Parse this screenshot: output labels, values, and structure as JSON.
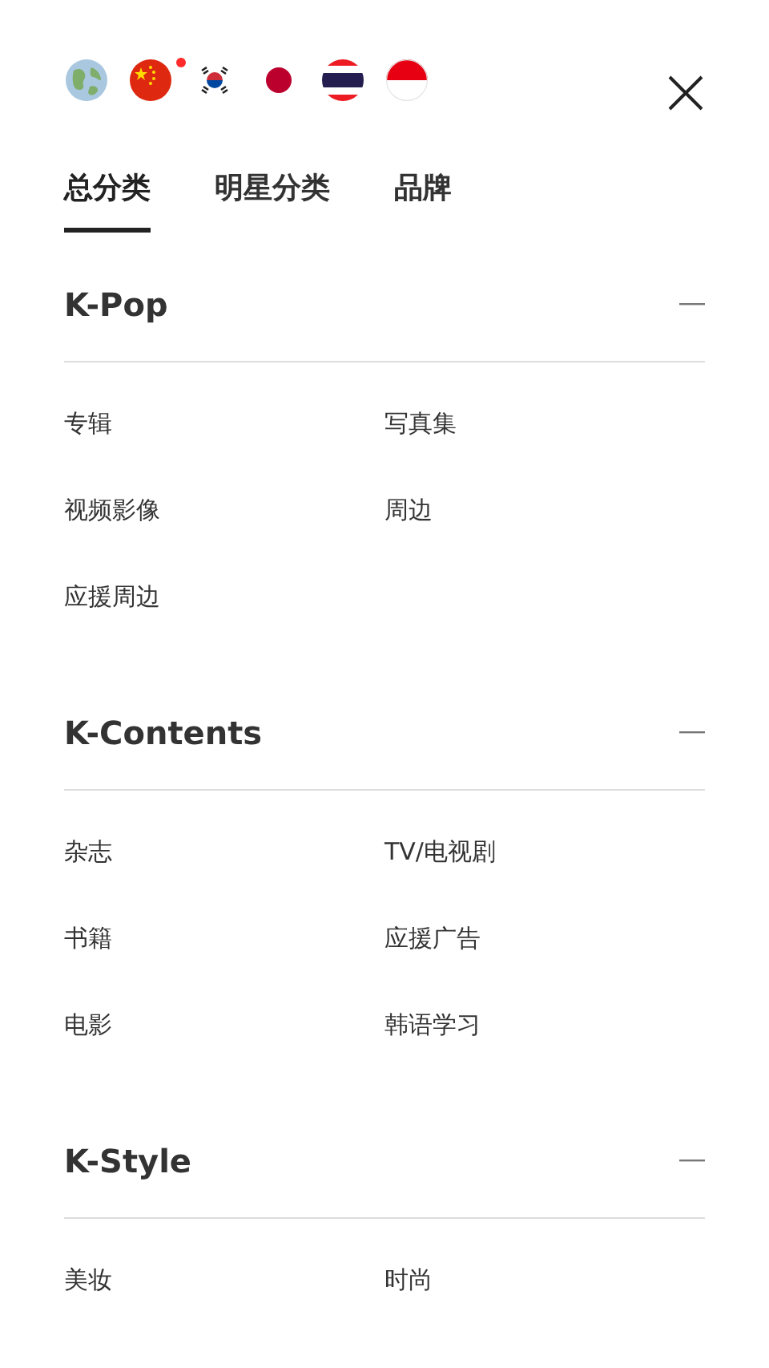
{
  "languages": [
    {
      "kind": "globe",
      "selected": false
    },
    {
      "kind": "china",
      "selected": true
    },
    {
      "kind": "korea",
      "selected": false
    },
    {
      "kind": "japan",
      "selected": false
    },
    {
      "kind": "thailand",
      "selected": false
    },
    {
      "kind": "indonesia",
      "selected": false
    }
  ],
  "tabs": [
    {
      "label": "总分类",
      "selected": true
    },
    {
      "label": "明星分类",
      "selected": false
    },
    {
      "label": "品牌",
      "selected": false
    }
  ],
  "sections": [
    {
      "title": "K-Pop",
      "expanded": true,
      "items": [
        "专辑",
        "写真集",
        "视频影像",
        "周边",
        "应援周边"
      ]
    },
    {
      "title": "K-Contents",
      "expanded": true,
      "items": [
        "杂志",
        "TV/电视剧",
        "书籍",
        "应援广告",
        "电影",
        "韩语学习"
      ]
    },
    {
      "title": "K-Style",
      "expanded": true,
      "items": [
        "美妆",
        "时尚"
      ]
    }
  ]
}
